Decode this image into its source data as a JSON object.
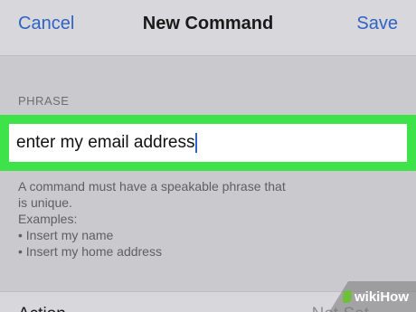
{
  "navbar": {
    "cancel_label": "Cancel",
    "title": "New Command",
    "save_label": "Save"
  },
  "phrase_section": {
    "header": "PHRASE",
    "input_value": "enter my email address",
    "footer_lines": [
      "A command must have a speakable phrase that",
      "is unique.",
      "Examples:",
      "• Insert my name",
      "• Insert my home address"
    ]
  },
  "action_row": {
    "label": "Action",
    "value": "Not Set"
  },
  "watermark": {
    "text": "wikiHow"
  },
  "colors": {
    "accent": "#2f63c4",
    "highlight": "#3ee34a",
    "background": "#c9c9ce"
  }
}
